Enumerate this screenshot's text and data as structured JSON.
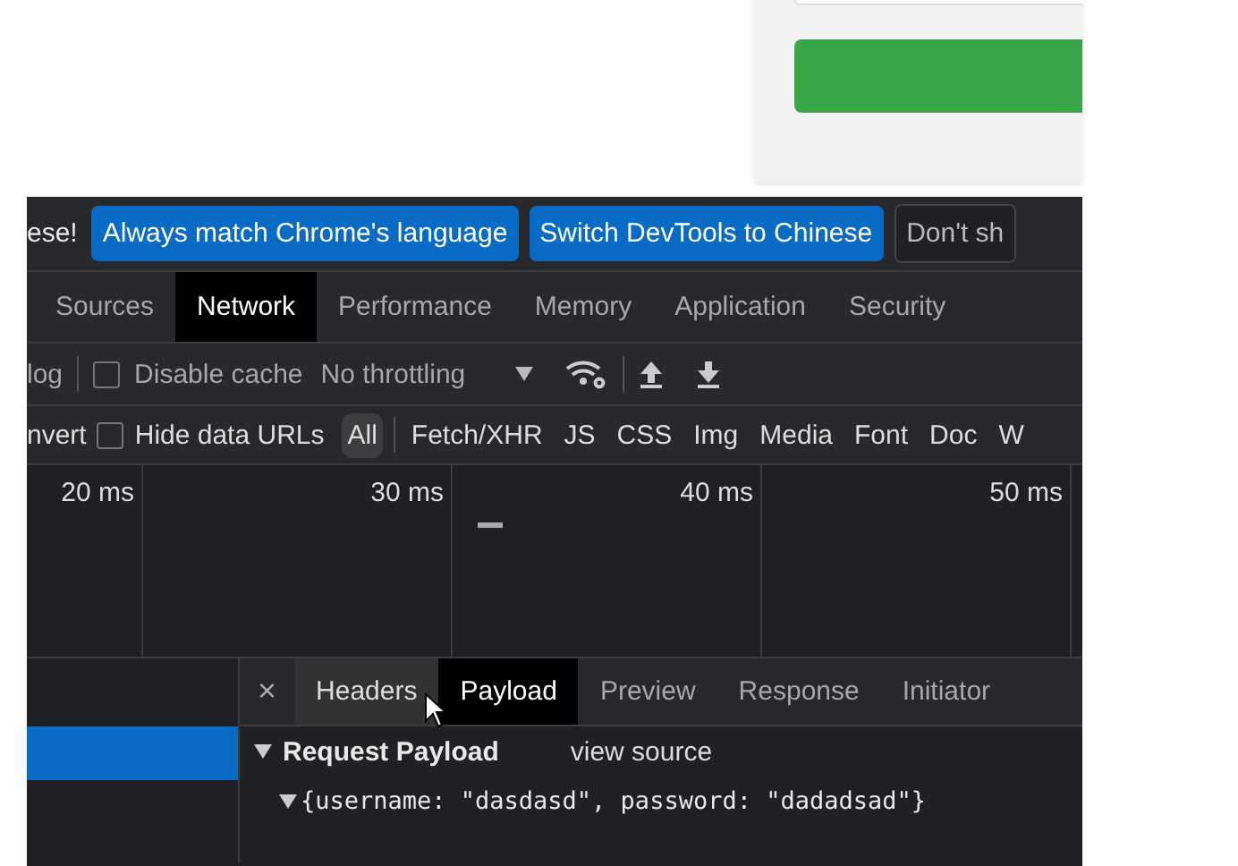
{
  "infobar": {
    "message": "ese!",
    "buttons": [
      {
        "label": "Always match Chrome's language",
        "kind": "primary"
      },
      {
        "label": "Switch DevTools to Chinese",
        "kind": "primary"
      },
      {
        "label": "Don't sh",
        "kind": "secondary"
      }
    ]
  },
  "tabs": [
    {
      "label": "Sources",
      "selected": false
    },
    {
      "label": "Network",
      "selected": true
    },
    {
      "label": "Performance",
      "selected": false
    },
    {
      "label": "Memory",
      "selected": false
    },
    {
      "label": "Application",
      "selected": false
    },
    {
      "label": "Security",
      "selected": false
    }
  ],
  "toolbar": {
    "preserve_log": "log",
    "disable_cache": {
      "label": "Disable cache",
      "checked": false
    },
    "throttling": "No throttling"
  },
  "filter": {
    "invert": "nvert",
    "hide_data_urls": {
      "label": "Hide data URLs",
      "checked": false
    },
    "types": [
      {
        "label": "All",
        "selected": true
      },
      {
        "label": "Fetch/XHR",
        "selected": false
      },
      {
        "label": "JS",
        "selected": false
      },
      {
        "label": "CSS",
        "selected": false
      },
      {
        "label": "Img",
        "selected": false
      },
      {
        "label": "Media",
        "selected": false
      },
      {
        "label": "Font",
        "selected": false
      },
      {
        "label": "Doc",
        "selected": false
      },
      {
        "label": "W",
        "selected": false
      }
    ]
  },
  "timeline": {
    "ticks": [
      "20 ms",
      "30 ms",
      "40 ms",
      "50 ms"
    ]
  },
  "requests": [
    {
      "selected": true
    }
  ],
  "detail": {
    "close": "×",
    "tabs": [
      {
        "label": "Headers",
        "selected": false,
        "hovered": true
      },
      {
        "label": "Payload",
        "selected": true,
        "hovered": false
      },
      {
        "label": "Preview",
        "selected": false,
        "hovered": false
      },
      {
        "label": "Response",
        "selected": false,
        "hovered": false
      },
      {
        "label": "Initiator",
        "selected": false,
        "hovered": false
      }
    ],
    "section": {
      "title": "Request Payload",
      "expanded": true,
      "view_source": "view source",
      "object": {
        "text": "{username: \"dasdasd\", password: \"dadadsad\"}",
        "expanded": true
      }
    }
  }
}
